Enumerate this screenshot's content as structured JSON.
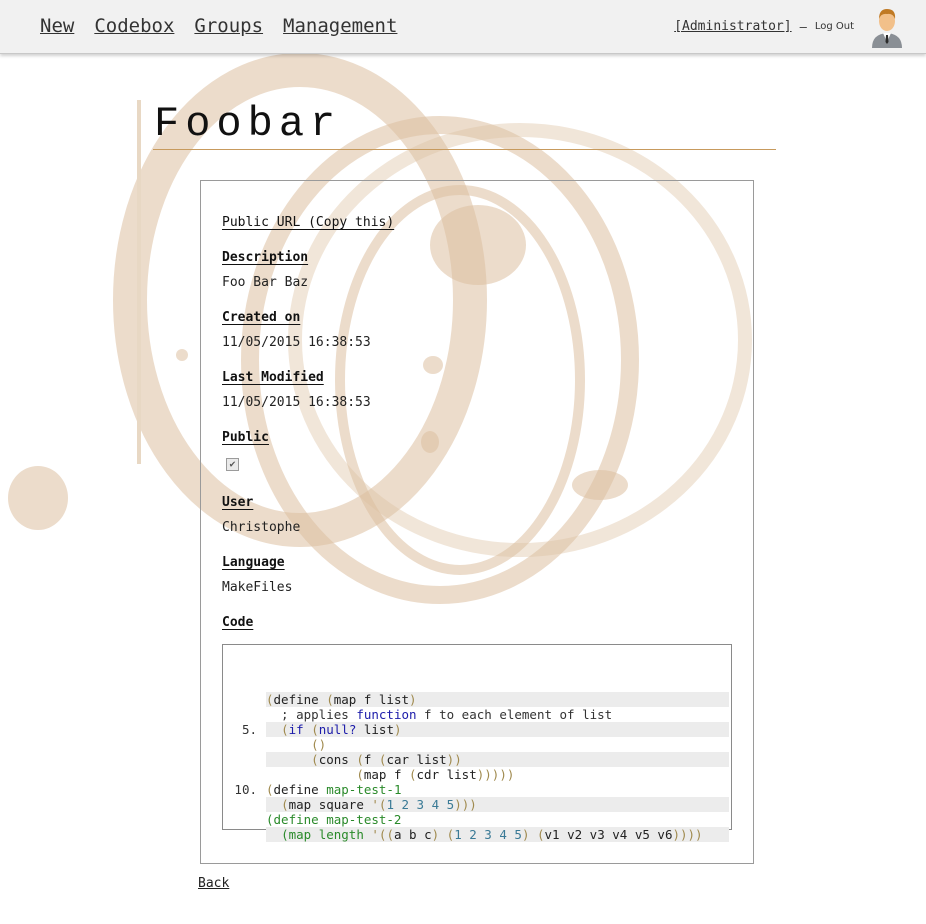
{
  "nav": {
    "items": [
      "New",
      "Codebox",
      "Groups",
      "Management"
    ],
    "user_label": "[Administrator]",
    "separator": "–",
    "logout_label": "Log Out"
  },
  "page": {
    "title": "Foobar",
    "back_label": "Back"
  },
  "details": {
    "public_url_label": "Public URL (Copy this)",
    "description_label": "Description",
    "description_value": "Foo Bar Baz",
    "created_label": "Created on",
    "created_value": "11/05/2015 16:38:53",
    "modified_label": "Last Modified",
    "modified_value": "11/05/2015 16:38:53",
    "public_label": "Public",
    "public_checked": true,
    "user_label": "User",
    "user_value": "Christophe",
    "language_label": "Language",
    "language_value": "MakeFiles",
    "code_label": "Code"
  },
  "code": {
    "line_numbers": [
      "",
      "",
      "",
      "5.",
      "",
      "",
      "",
      "10.",
      "",
      ""
    ],
    "lines": [
      "(define (map f list)",
      "  ; applies function f to each element of list",
      "  (if (null? list)",
      "      ()",
      "      (cons (f (car list))",
      "            (map f (cdr list)))))",
      "(define map-test-1",
      "  (map square '(1 2 3 4 5)))",
      "(define map-test-2",
      "  (map length '((a b c) (1 2 3 4 5) (v1 v2 v3 v4 v5 v6))))"
    ]
  },
  "colors": {
    "accent_rule": "#c79a5d",
    "stain": "#d8b48f"
  }
}
